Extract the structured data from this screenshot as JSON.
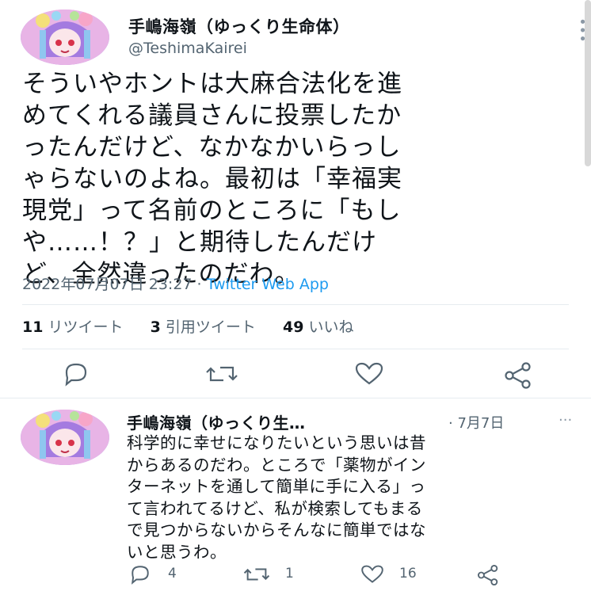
{
  "main_tweet": {
    "display_name": "手嶋海嶺（ゆっくり生命体）",
    "handle": "@TeshimaKairei",
    "text_lines": [
      "そういやホントは大麻合法化を進",
      "めてくれる議員さんに投票したか",
      "ったんだけど、なかなかいらっし",
      "ゃらないのよね。最初は「幸福実",
      "現党」って名前のところに「もし",
      "や……！？」と期待したんだけ",
      "ど、全然違ったのだわ。"
    ],
    "timestamp": "2022年07月07日 23:27",
    "separator": " · ",
    "source": "Twitter Web App",
    "stats": {
      "retweets_count": "11",
      "retweets_label": "リツイート",
      "quotes_count": "3",
      "quotes_label": "引用ツイート",
      "likes_count": "49",
      "likes_label": "いいね"
    },
    "actions": [
      "reply-icon",
      "retweet-icon",
      "like-icon",
      "share-icon"
    ]
  },
  "reply_tweet": {
    "display_name": "手嶋海嶺（ゆっくり生…",
    "date": "· 7月7日",
    "text_lines": [
      "科学的に幸せになりたいという思いは昔",
      "からあるのだわ。ところで「薬物がイン",
      "ターネットを通して簡単に手に入る」っ",
      "て言われてるけど、私が検索してもまる",
      "で見つからないからそんなに簡単ではな",
      "いと思うわ。"
    ],
    "reply_count": "4",
    "retweet_count": "1",
    "like_count": "16"
  },
  "colors": {
    "text": "#0f1419",
    "secondary": "#536471",
    "link": "#1d9bf0",
    "divider": "#e6ecf0"
  }
}
